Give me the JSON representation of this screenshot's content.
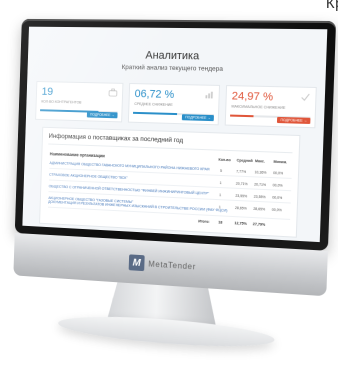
{
  "corner_text": "Кр",
  "brand": {
    "logo_letter": "M",
    "name": "MetaTender"
  },
  "screen": {
    "title": "Аналитика",
    "subtitle": "Краткий анализ текущего тендера",
    "cards": [
      {
        "value": "19",
        "label": "кол-во контрагентов",
        "button": "подробнее →",
        "color": "#2a8fc9",
        "fill": 0.75,
        "icon": "briefcase-icon"
      },
      {
        "value": "06,72 %",
        "label": "среднее снижение",
        "button": "подробнее →",
        "color": "#2a8fc9",
        "fill": 0.55,
        "icon": "chart-icon"
      },
      {
        "value": "24,97 %",
        "label": "максимальное снижение",
        "button": "подробнее →",
        "color": "#e0563a",
        "fill": 0.3,
        "icon": "check-icon"
      }
    ],
    "panel": {
      "title": "Информация о поставщиках за последний год",
      "columns": {
        "org": "Наименование организации",
        "count": "Кол-во",
        "avg": "Средний",
        "max": "Макс.",
        "min": "Миним."
      },
      "rows": [
        {
          "org": "АДМИНИСТРАЦИЯ ОБЩЕСТВО ГАВАНСКОГО МУНИЦИПАЛЬНОГО РАЙОНА НИЖНЕВОГО КРАЯ",
          "org2": "",
          "count": "5",
          "avg": "7,77%",
          "max": "10,36%",
          "min": "00,0%"
        },
        {
          "org": "СТРАХОВОЕ АКЦИОНЕРНОЕ ОБЩЕСТВО \"ВСК\"",
          "org2": "",
          "count": "1",
          "avg": "20,71%",
          "max": "20,71%",
          "min": "00,0%"
        },
        {
          "org": "ОБЩЕСТВО С ОГРАНИЧЕННОЙ ОТВЕТСТВЕННОСТЬЮ \"ФИНВЕЙ ИНЖИНИРИНГОВЫЙ ЦЕНТР\"",
          "org2": "",
          "count": "1",
          "avg": "23,55%",
          "max": "23,55%",
          "min": "00,0%"
        },
        {
          "org": "АКЦИОНЕРНОЕ ОБЩЕСТВО \"ГАЗОВЫЕ СИСТЕМЫ\"",
          "org2": "ДОКУМЕНТАЦИЯ И РЕЗУЛЬТАТОВ ИНЖЕНЕРНЫХ ИЗЫСКАНИЙ В СТРОИТЕЛЬСТВЕ РОССИИ (ФАУ ФЦСИ)",
          "count": "1",
          "avg": "28,65%",
          "max": "28,65%",
          "min": "00,0%"
        }
      ],
      "total": {
        "label": "Итого:",
        "count": "18",
        "avg": "12,75%",
        "max": "27,79%"
      }
    }
  }
}
